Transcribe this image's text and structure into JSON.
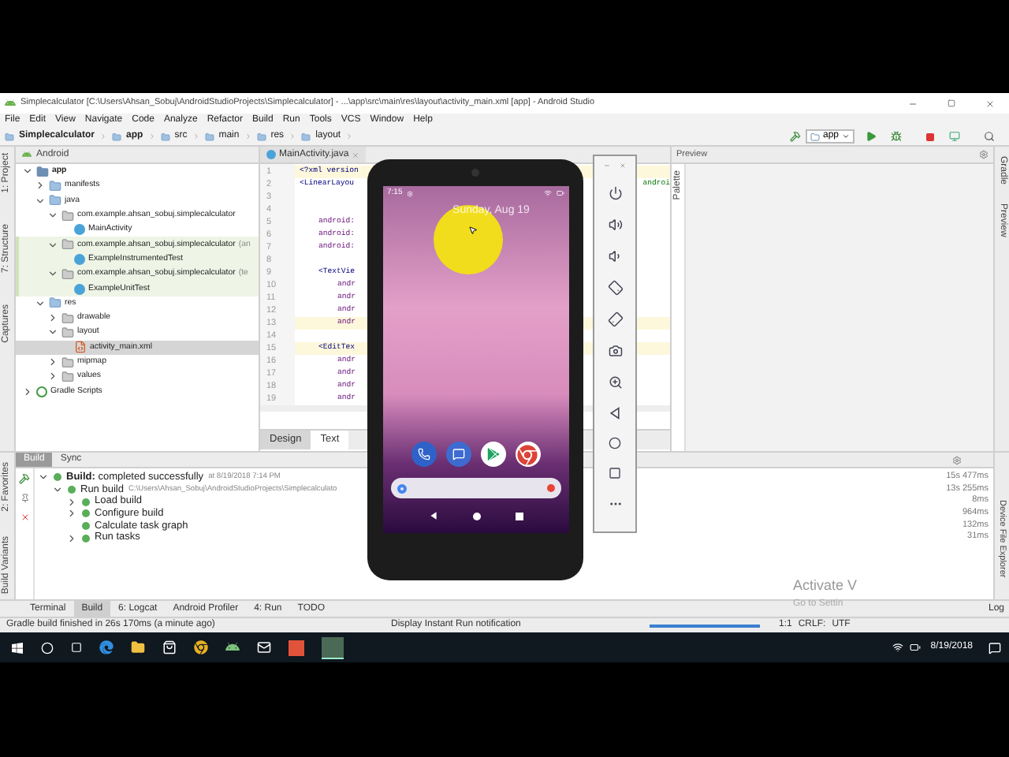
{
  "window": {
    "title": "Simplecalculator [C:\\Users\\Ahsan_Sobuj\\AndroidStudioProjects\\Simplecalculator] - ...\\app\\src\\main\\res\\layout\\activity_main.xml [app] - Android Studio"
  },
  "menu": [
    "File",
    "Edit",
    "View",
    "Navigate",
    "Code",
    "Analyze",
    "Refactor",
    "Build",
    "Run",
    "Tools",
    "VCS",
    "Window",
    "Help"
  ],
  "breadcrumbs": [
    "Simplecalculator",
    "app",
    "src",
    "main",
    "res",
    "layout"
  ],
  "run_config": "app",
  "left_tool_tabs": [
    "1: Project",
    "7: Structure",
    "Captures"
  ],
  "project_panel": {
    "view": "Android",
    "tree": [
      {
        "label": "app",
        "kind": "module",
        "expanded": true,
        "selected": false,
        "tinted": false,
        "children": [
          {
            "label": "manifests",
            "kind": "folder",
            "expanded": false,
            "selected": false,
            "tinted": false
          },
          {
            "label": "java",
            "kind": "folder",
            "expanded": true,
            "selected": false,
            "tinted": false,
            "children": [
              {
                "label": "com.example.ahsan_sobuj.simplecalculator",
                "kind": "package",
                "expanded": true,
                "selected": false,
                "tinted": false,
                "children": [
                  {
                    "label": "MainActivity",
                    "kind": "class",
                    "selected": false,
                    "tinted": false
                  }
                ]
              },
              {
                "label": "com.example.ahsan_sobuj.simplecalculator",
                "suffix": "(an",
                "kind": "package",
                "expanded": true,
                "selected": false,
                "tinted": true,
                "children": [
                  {
                    "label": "ExampleInstrumentedTest",
                    "kind": "class",
                    "selected": false,
                    "tinted": true
                  }
                ]
              },
              {
                "label": "com.example.ahsan_sobuj.simplecalculator",
                "suffix": "(te",
                "kind": "package",
                "expanded": true,
                "selected": false,
                "tinted": true,
                "children": [
                  {
                    "label": "ExampleUnitTest",
                    "kind": "class",
                    "selected": false,
                    "tinted": true
                  }
                ]
              }
            ]
          },
          {
            "label": "res",
            "kind": "folder",
            "expanded": true,
            "selected": false,
            "tinted": false,
            "children": [
              {
                "label": "drawable",
                "kind": "package",
                "expanded": false,
                "selected": false,
                "tinted": false
              },
              {
                "label": "layout",
                "kind": "package",
                "expanded": true,
                "selected": false,
                "tinted": false,
                "children": [
                  {
                    "label": "activity_main.xml",
                    "kind": "xml",
                    "selected": true,
                    "tinted": false
                  }
                ]
              },
              {
                "label": "mipmap",
                "kind": "package",
                "expanded": false,
                "selected": false,
                "tinted": false
              },
              {
                "label": "values",
                "kind": "package",
                "expanded": false,
                "selected": false,
                "tinted": false
              }
            ]
          }
        ]
      },
      {
        "label": "Gradle Scripts",
        "kind": "gradle",
        "expanded": false,
        "selected": false,
        "tinted": false
      }
    ]
  },
  "editor": {
    "tabs": [
      {
        "label": "MainActivity.java",
        "selected": false
      }
    ],
    "lines": [
      {
        "number": "1",
        "code": "<?xml version",
        "kind": "tag",
        "warning": true
      },
      {
        "number": "2",
        "code": "<LinearLayou",
        "right": "androi",
        "kind": "tag",
        "warning": false
      },
      {
        "number": "3",
        "kind": "blank",
        "warning": false
      },
      {
        "number": "4",
        "kind": "blank",
        "warning": false
      },
      {
        "number": "5",
        "code": "android:",
        "kind": "attr",
        "warning": false
      },
      {
        "number": "6",
        "code": "android:",
        "kind": "attr",
        "warning": false
      },
      {
        "number": "7",
        "code": "android:",
        "kind": "attr",
        "warning": false
      },
      {
        "number": "8",
        "kind": "blank",
        "warning": false
      },
      {
        "number": "9",
        "code": "<TextVie",
        "kind": "child_tag",
        "warning": false
      },
      {
        "number": "10",
        "code": "andr",
        "kind": "child_attr",
        "warning": false
      },
      {
        "number": "11",
        "code": "andr",
        "kind": "child_attr",
        "warning": false
      },
      {
        "number": "12",
        "code": "andr",
        "kind": "child_attr",
        "warning": false
      },
      {
        "number": "13",
        "code": "andr",
        "kind": "child_attr",
        "warning": true
      },
      {
        "number": "14",
        "kind": "blank",
        "warning": false
      },
      {
        "number": "15",
        "code": "<EditTex",
        "kind": "child_tag",
        "warning": true
      },
      {
        "number": "16",
        "code": "andr",
        "kind": "child_attr",
        "warning": false
      },
      {
        "number": "17",
        "code": "andr",
        "kind": "child_attr",
        "warning": false
      },
      {
        "number": "18",
        "code": "andr",
        "kind": "child_attr",
        "warning": false
      },
      {
        "number": "19",
        "code": "andr",
        "kind": "child_attr",
        "warning": false
      }
    ],
    "mode_tabs": [
      {
        "label": "Design",
        "selected": false
      },
      {
        "label": "Text",
        "selected": true
      }
    ]
  },
  "preview": {
    "title": "Preview",
    "side_tab": "Palette"
  },
  "right_tool_tabs": [
    "Gradle",
    "Preview"
  ],
  "build_panel": {
    "tabs": [
      {
        "label": "Build",
        "selected": true
      },
      {
        "label": "Sync",
        "selected": false
      }
    ],
    "tree": [
      {
        "label": "**Build:** completed successfully",
        "detail": "at 8/19/2018 7:14 PM",
        "duration": "15s 477ms",
        "expanded": true,
        "children": [
          {
            "label": "Run build",
            "detail": "C:\\Users\\Ahsan_Sobuj\\AndroidStudioProjects\\Simplecalculato",
            "duration": "13s 255ms",
            "expanded": true,
            "children": [
              {
                "label": "Load build",
                "duration": "8ms",
                "expanded": false
              },
              {
                "label": "Configure build",
                "duration": "964ms",
                "expanded": false
              },
              {
                "label": "Calculate task graph",
                "duration": "132ms"
              },
              {
                "label": "Run tasks",
                "duration": "31ms",
                "expanded": false
              }
            ]
          }
        ]
      }
    ]
  },
  "left_bottom_tool_tabs": [
    "2: Favorites",
    "Build Variants"
  ],
  "right_bottom_tool_tabs": [
    "Device File Explorer"
  ],
  "bottom_tabs": [
    {
      "label": "Terminal",
      "selected": false
    },
    {
      "label": "Build",
      "selected": true
    },
    {
      "label": "6: Logcat",
      "selected": false
    },
    {
      "label": "Android Profiler",
      "selected": false
    },
    {
      "label": "4: Run",
      "selected": false
    },
    {
      "label": "TODO",
      "selected": false
    }
  ],
  "bottom_right_tab": "Log",
  "status_bar": {
    "message": "Gradle build finished in 26s 170ms (a minute ago)",
    "notification": "Display Instant Run notification",
    "level": 1,
    "position": "1:1",
    "line_separator": "CRLF:",
    "encoding": "UTF"
  },
  "activation_notice": {
    "title": "Activate V",
    "subtitle": "Go to Settin"
  },
  "phone": {
    "time": "7:15",
    "date": "Sunday, Aug 19"
  },
  "taskbar": {
    "date": "8/19/2018"
  }
}
